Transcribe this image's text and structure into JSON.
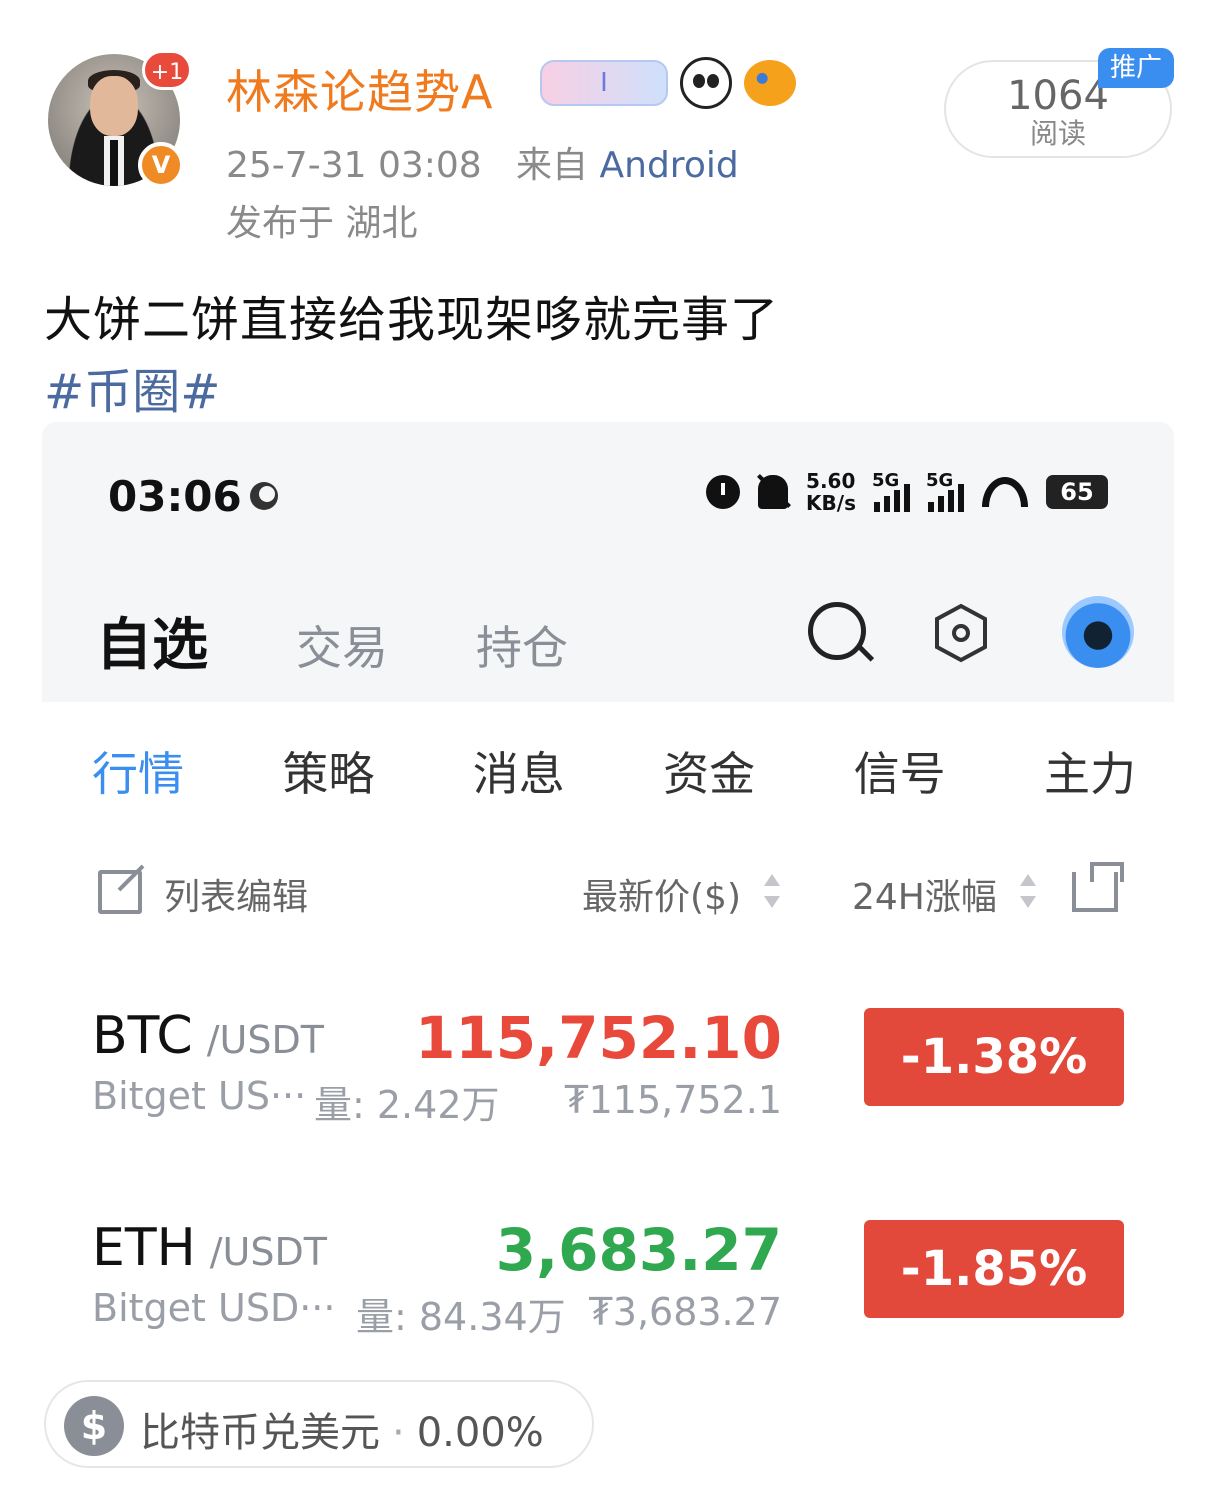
{
  "post": {
    "username": "林森论趋势A",
    "plus_badge": "+1",
    "verified_badge": "V",
    "deco_card_text": "I",
    "timestamp": "25-7-31 03:08",
    "source_prefix": "来自",
    "source": "Android",
    "location": "发布于 湖北",
    "read_count": "1064",
    "read_label": "阅读",
    "promo_tag": "推广",
    "text": "大饼二饼直接给我现架哆就完事了",
    "hashtag": "#币圈#"
  },
  "screenshot": {
    "status_bar": {
      "time": "03:06",
      "speed_value": "5.60",
      "speed_unit": "KB/s",
      "signal1_label": "5G",
      "signal2_label": "5G",
      "battery": "65"
    },
    "top_tabs": [
      "自选",
      "交易",
      "持仓"
    ],
    "sub_tabs": [
      "行情",
      "策略",
      "消息",
      "资金",
      "信号",
      "主力"
    ],
    "list_header": {
      "edit": "列表编辑",
      "price": "最新价($)",
      "change": "24H涨幅"
    },
    "rows": [
      {
        "symbol": "BTC",
        "quote": "/USDT",
        "exchange": "Bitget US···",
        "volume": "量: 2.42万",
        "price": "115,752.10",
        "fiat": "₮115,752.1",
        "change": "-1.38%",
        "price_color": "#e8493b"
      },
      {
        "symbol": "ETH",
        "quote": "/USDT",
        "exchange": "Bitget USD···",
        "volume": "量: 84.34万",
        "price": "3,683.27",
        "fiat": "₮3,683.27",
        "change": "-1.85%",
        "price_color": "#2fa84f"
      }
    ]
  },
  "rate_pill": {
    "icon": "$",
    "label": "比特币兑美元",
    "separator": "·",
    "value": "0.00%"
  },
  "colors": {
    "username": "#f07b1f",
    "link": "#4b6aa0",
    "active_tab": "#3a8ef0",
    "change_box": "#e2493b"
  }
}
